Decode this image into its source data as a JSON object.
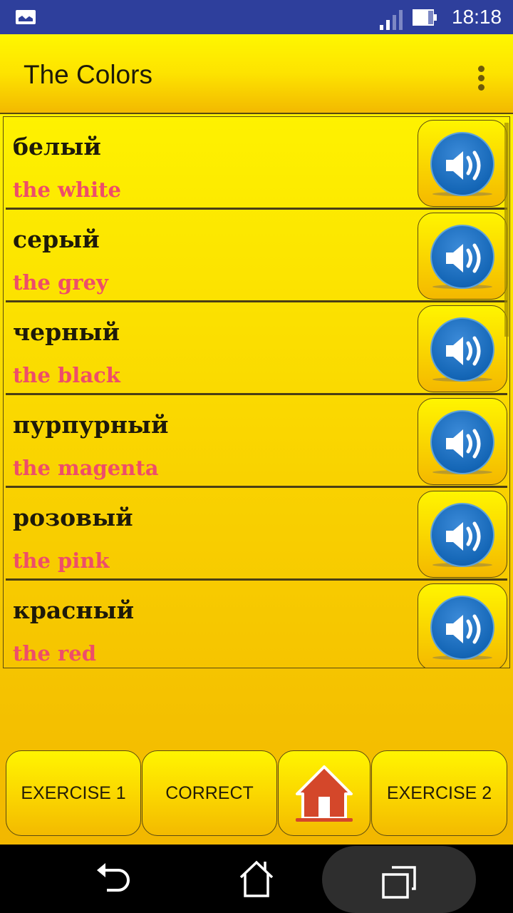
{
  "status_bar": {
    "notification_icon": "gallery-icon",
    "signal_icon": "cell-signal-icon",
    "battery_icon": "battery-icon",
    "time": "18:18"
  },
  "app_bar": {
    "title": "The Colors",
    "overflow_icon": "more-vert-icon"
  },
  "words": [
    {
      "russian": "белый",
      "english": "the white",
      "action_icon": "speaker-icon"
    },
    {
      "russian": "серый",
      "english": "the grey",
      "action_icon": "speaker-icon"
    },
    {
      "russian": "черный",
      "english": "the black",
      "action_icon": "speaker-icon"
    },
    {
      "russian": "пурпурный",
      "english": "the magenta",
      "action_icon": "speaker-icon"
    },
    {
      "russian": "розовый",
      "english": "the pink",
      "action_icon": "speaker-icon"
    },
    {
      "russian": "красный",
      "english": "the red",
      "action_icon": "speaker-icon"
    }
  ],
  "bottom_buttons": {
    "exercise1": "EXERCISE 1",
    "correct": "CORRECT",
    "home_icon": "home-icon",
    "exercise2": "EXERCISE 2"
  },
  "nav_bar": {
    "back_icon": "back-icon",
    "home_icon": "home-outline-icon",
    "recents_icon": "recents-icon"
  },
  "colors": {
    "status_bar": "#2e3f9c",
    "app_bar_top": "#fff700",
    "app_bar_bottom": "#f3b900",
    "russian_text": "#1e1a0a",
    "english_text": "#ee4d6a",
    "speaker_disc": "#1466b6",
    "home_house": "#d4472a"
  }
}
